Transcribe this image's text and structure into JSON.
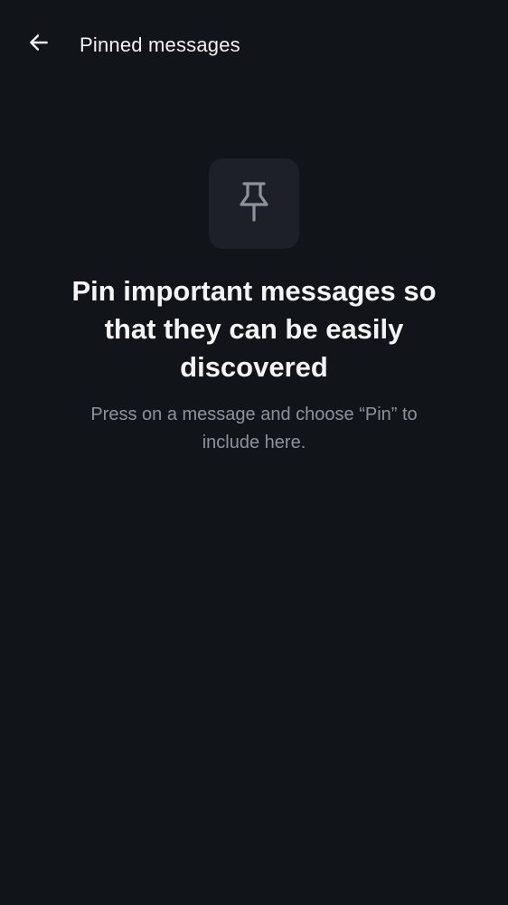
{
  "header": {
    "title": "Pinned messages",
    "back_icon": "arrow-left-icon"
  },
  "empty_state": {
    "icon": "pushpin-icon",
    "title": "Pin important messages so that they can be easily discovered",
    "subtitle": "Press on a message and choose “Pin” to include here."
  },
  "colors": {
    "background": "#111419",
    "tile": "#1d2026",
    "title_text": "#f4f5f7",
    "subtitle_text": "#8d939c",
    "icon": "#8d939c"
  }
}
